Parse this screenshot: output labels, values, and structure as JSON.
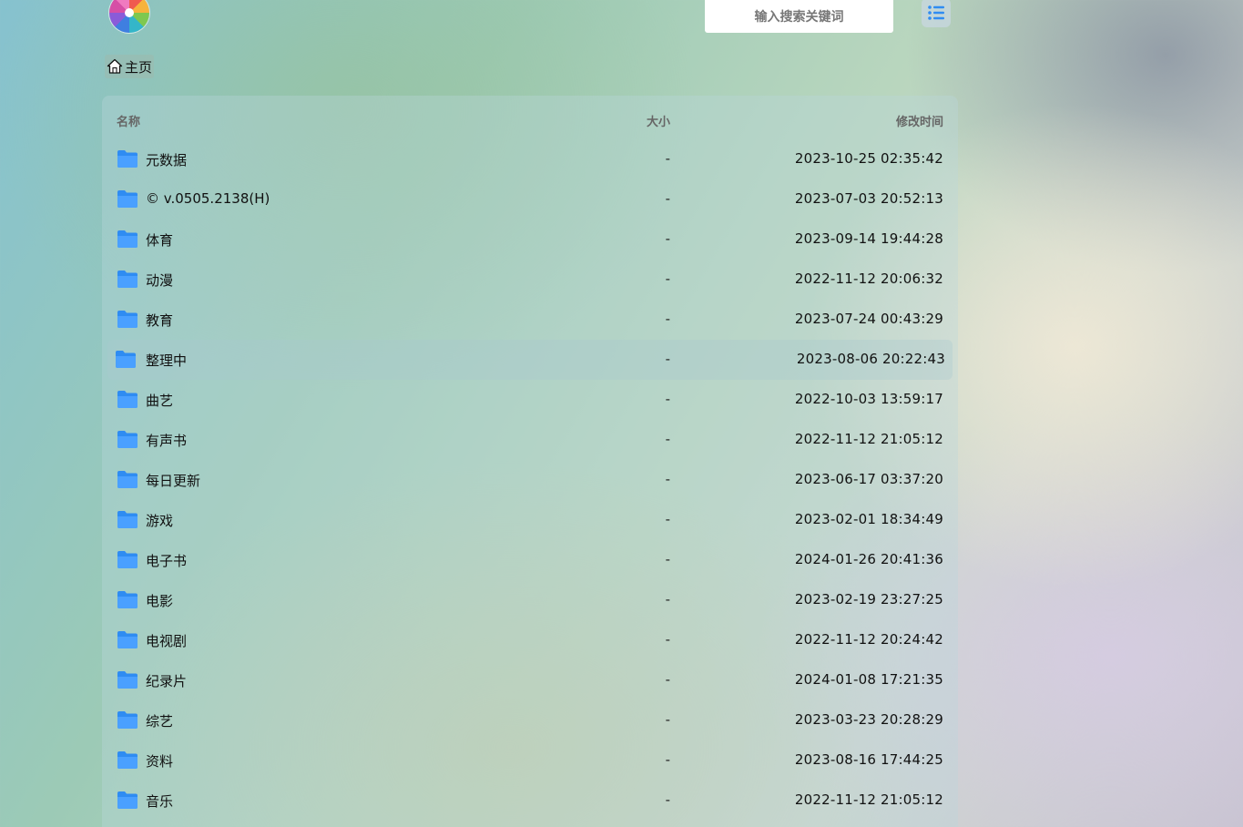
{
  "search": {
    "placeholder": "输入搜索关键词"
  },
  "icons": {
    "logo": "colorful-pinwheel-logo",
    "list": "list-view-icon",
    "home": "home-icon",
    "folder": "folder-icon"
  },
  "colors": {
    "folder": "#2f8cf2",
    "list_icon": "#2f8cf2"
  },
  "breadcrumb": {
    "label": "主页"
  },
  "table": {
    "headers": {
      "name": "名称",
      "size": "大小",
      "mtime": "修改时间"
    },
    "rows": [
      {
        "name": "元数据",
        "size": "-",
        "mtime": "2023-10-25 02:35:42"
      },
      {
        "name": "© v.0505.2138(H)",
        "size": "-",
        "mtime": "2023-07-03 20:52:13"
      },
      {
        "name": "体育",
        "size": "-",
        "mtime": "2023-09-14 19:44:28"
      },
      {
        "name": "动漫",
        "size": "-",
        "mtime": "2022-11-12 20:06:32"
      },
      {
        "name": "教育",
        "size": "-",
        "mtime": "2023-07-24 00:43:29"
      },
      {
        "name": "整理中",
        "size": "-",
        "mtime": "2023-08-06 20:22:43"
      },
      {
        "name": "曲艺",
        "size": "-",
        "mtime": "2022-10-03 13:59:17"
      },
      {
        "name": "有声书",
        "size": "-",
        "mtime": "2022-11-12 21:05:12"
      },
      {
        "name": "每日更新",
        "size": "-",
        "mtime": "2023-06-17 03:37:20"
      },
      {
        "name": "游戏",
        "size": "-",
        "mtime": "2023-02-01 18:34:49"
      },
      {
        "name": "电子书",
        "size": "-",
        "mtime": "2024-01-26 20:41:36"
      },
      {
        "name": "电影",
        "size": "-",
        "mtime": "2023-02-19 23:27:25"
      },
      {
        "name": "电视剧",
        "size": "-",
        "mtime": "2022-11-12 20:24:42"
      },
      {
        "name": "纪录片",
        "size": "-",
        "mtime": "2024-01-08 17:21:35"
      },
      {
        "name": "综艺",
        "size": "-",
        "mtime": "2023-03-23 20:28:29"
      },
      {
        "name": "资料",
        "size": "-",
        "mtime": "2023-08-16 17:44:25"
      },
      {
        "name": "音乐",
        "size": "-",
        "mtime": "2022-11-12 21:05:12"
      }
    ]
  }
}
